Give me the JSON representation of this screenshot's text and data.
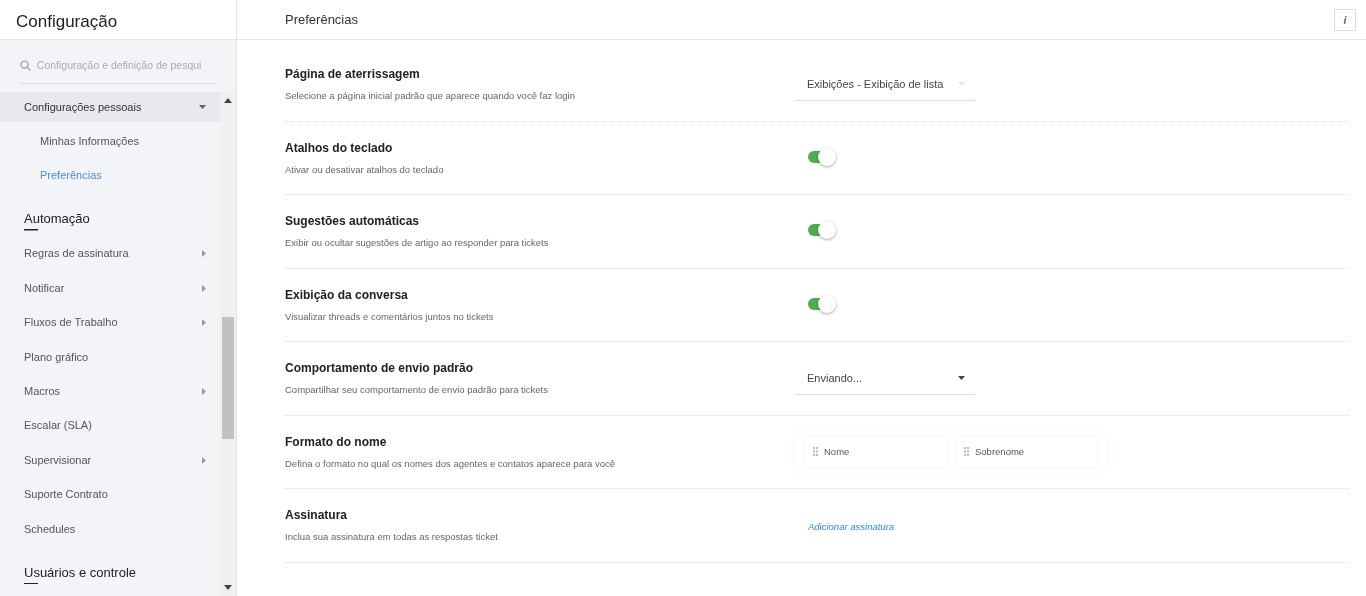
{
  "sidebar": {
    "title": "Configuração",
    "search": {
      "placeholder": "Configuração e definição de pesqui"
    },
    "items": [
      {
        "kind": "parent",
        "label": "Configurações pessoais",
        "expanded": true,
        "children": [
          {
            "label": "Minhas Informações",
            "selected": false
          },
          {
            "label": "Preferências",
            "selected": true
          }
        ]
      },
      {
        "kind": "heading",
        "label": "Automação"
      },
      {
        "kind": "item",
        "label": "Regras de assinatura",
        "has_submenu": true
      },
      {
        "kind": "item",
        "label": "Notificar",
        "has_submenu": true
      },
      {
        "kind": "item",
        "label": "Fluxos de Trabalho",
        "has_submenu": true
      },
      {
        "kind": "item",
        "label": "Plano gráfico",
        "has_submenu": false
      },
      {
        "kind": "item",
        "label": "Macros",
        "has_submenu": true
      },
      {
        "kind": "item",
        "label": "Escalar (SLA)",
        "has_submenu": false
      },
      {
        "kind": "item",
        "label": "Supervisionar",
        "has_submenu": true
      },
      {
        "kind": "item",
        "label": "Suporte Contrato",
        "has_submenu": false
      },
      {
        "kind": "item",
        "label": "Schedules",
        "has_submenu": false
      },
      {
        "kind": "heading",
        "label": "Usuários e controle"
      }
    ]
  },
  "page": {
    "title": "Preferências",
    "info_button": "i"
  },
  "settings": [
    {
      "kind": "dropdown",
      "title": "Página de aterrissagem",
      "description": "Selecione a página inicial padrão que aparece quando você faz login",
      "value": "Exibições - Exibição de lista",
      "disabled": true
    },
    {
      "kind": "toggle",
      "title": "Atalhos do teclado",
      "description": "Ativar ou desativar atalhos do teclado",
      "on": true
    },
    {
      "kind": "toggle",
      "title": "Sugestões automáticas",
      "description": "Exibir ou ocultar sugestões de artigo ao responder para tickets",
      "on": true
    },
    {
      "kind": "toggle",
      "title": "Exibição da conversa",
      "description": "Visualizar threads e comentários juntos no tickets",
      "on": true
    },
    {
      "kind": "dropdown",
      "title": "Comportamento de envio padrão",
      "description": "Compartilhar seu comportamento de envio padrão para tickets",
      "value": "Enviando...",
      "disabled": false
    },
    {
      "kind": "name_format",
      "title": "Formato do nome",
      "description": "Defina o formato no qual os nomes dos agentes e contatos aparece para você",
      "parts": [
        "Nome",
        "Sobrenome"
      ]
    },
    {
      "kind": "link",
      "title": "Assinatura",
      "description": "Inclua sua assinatura em todas as respostas ticket",
      "link": "Adicionar assinatura"
    }
  ]
}
